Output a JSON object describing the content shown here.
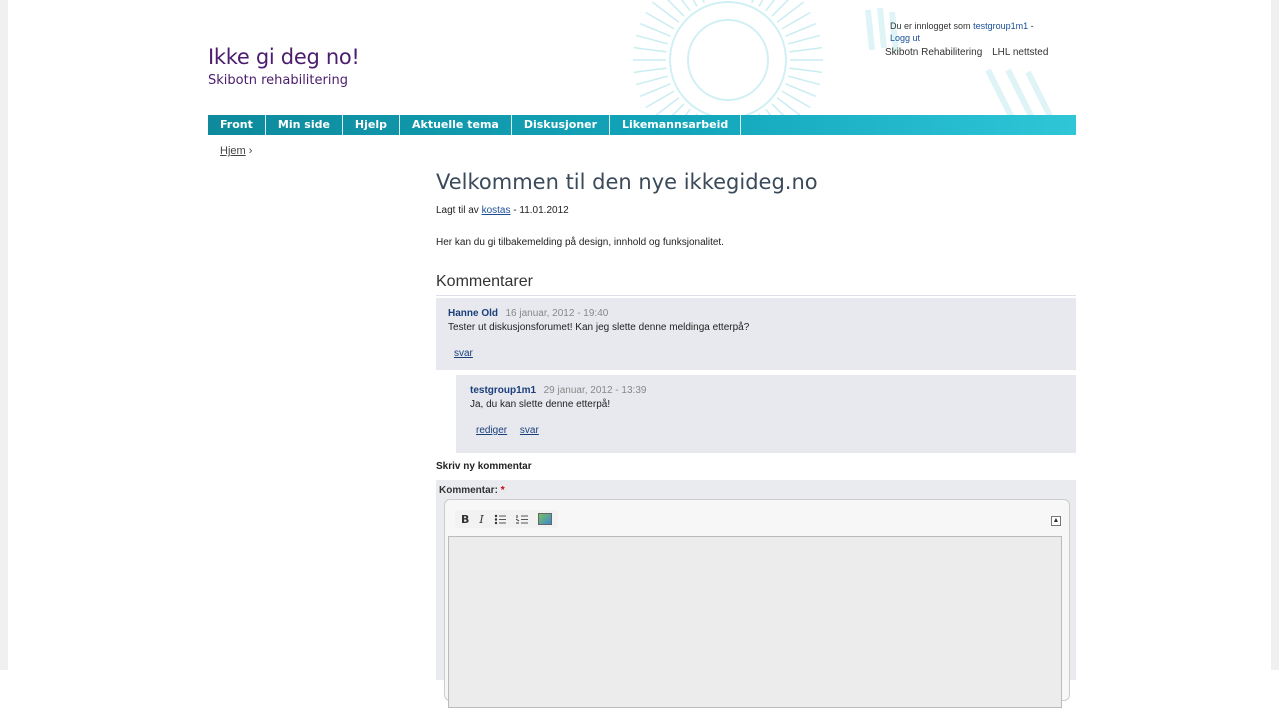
{
  "site": {
    "title": "Ikke gi deg no!",
    "subtitle": "Skibotn rehabilitering"
  },
  "user": {
    "logged_in_text": "Du er innlogget som",
    "username": "testgroup1m1",
    "separator": "-",
    "logout": "Logg ut"
  },
  "toplinks": [
    "Skibotn Rehabilitering",
    "LHL nettsted"
  ],
  "nav": [
    "Front",
    "Min side",
    "Hjelp",
    "Aktuelle tema",
    "Diskusjoner",
    "Likemannsarbeid"
  ],
  "breadcrumb": {
    "home": "Hjem",
    "sep": "›"
  },
  "article": {
    "title": "Velkommen til den nye ikkegideg.no",
    "meta_prefix": "Lagt til av",
    "author": "kostas",
    "meta_suffix": "- 11.01.2012",
    "body": "Her kan du gi tilbakemelding på design, innhold og funksjonalitet."
  },
  "comments": {
    "heading": "Kommentarer",
    "items": [
      {
        "author": "Hanne Old",
        "date": "16 januar, 2012 - 19:40",
        "text": "Tester ut diskusjonsforumet! Kan jeg slette denne meldinga etterpå?",
        "links": [
          "svar"
        ]
      },
      {
        "author": "testgroup1m1",
        "date": "29 januar, 2012 - 13:39",
        "text": "Ja, du kan slette denne etterpå!",
        "links": [
          "rediger",
          "svar"
        ]
      }
    ]
  },
  "new_comment": {
    "heading": "Skriv ny kommentar",
    "label": "Kommentar:",
    "required_mark": "*",
    "toolbar": {
      "bold": "B",
      "italic": "I",
      "bullet_list_icon": "bullet-list-icon",
      "numbered_list_icon": "numbered-list-icon",
      "image_icon": "image-icon"
    }
  }
}
